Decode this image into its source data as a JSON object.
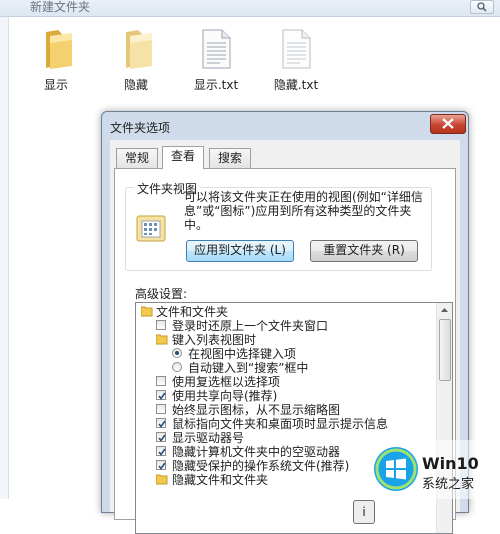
{
  "explorer": {
    "folder_name": "新建文件夹",
    "files": [
      {
        "name": "显示",
        "type": "folder"
      },
      {
        "name": "隐藏",
        "type": "folder"
      },
      {
        "name": "显示.txt",
        "type": "text-file"
      },
      {
        "name": "隐藏.txt",
        "type": "text-file"
      }
    ]
  },
  "dialog": {
    "title": "文件夹选项",
    "tabs": [
      "常规",
      "查看",
      "搜索"
    ],
    "active_tab": "查看",
    "folder_views": {
      "group_title": "文件夹视图",
      "description": "可以将该文件夹正在使用的视图(例如“详细信息”或“图标”)应用到所有这种类型的文件夹中。",
      "apply_button": "应用到文件夹 (L)",
      "reset_button": "重置文件夹 (R)"
    },
    "advanced_label": "高级设置:",
    "settings": [
      {
        "kind": "folder",
        "checked": null,
        "label": "文件和文件夹"
      },
      {
        "kind": "checkbox",
        "checked": false,
        "label": "登录时还原上一个文件夹窗口"
      },
      {
        "kind": "subfolder",
        "checked": null,
        "label": "键入列表视图时"
      },
      {
        "kind": "radio",
        "checked": true,
        "label": "在视图中选择键入项"
      },
      {
        "kind": "radio",
        "checked": false,
        "label": "自动键入到“搜索”框中"
      },
      {
        "kind": "checkbox",
        "checked": false,
        "label": "使用复选框以选择项"
      },
      {
        "kind": "checkbox",
        "checked": true,
        "label": "使用共享向导(推荐)"
      },
      {
        "kind": "checkbox",
        "checked": false,
        "label": "始终显示图标，从不显示缩略图"
      },
      {
        "kind": "checkbox",
        "checked": true,
        "label": "鼠标指向文件夹和桌面项时显示提示信息"
      },
      {
        "kind": "checkbox",
        "checked": true,
        "label": "显示驱动器号"
      },
      {
        "kind": "checkbox",
        "checked": true,
        "label": "隐藏计算机文件夹中的空驱动器"
      },
      {
        "kind": "checkbox",
        "checked": true,
        "label": "隐藏受保护的操作系统文件(推荐)"
      },
      {
        "kind": "subfolder",
        "checked": null,
        "label": "隐藏文件和文件夹"
      }
    ],
    "bottom_button_partial": "i"
  },
  "watermark": {
    "brand": "Win10",
    "site": "系统之家"
  },
  "colors": {
    "dialog_frame": "#cfdbea",
    "close_button": "#c7462f",
    "folder_yellow": "#f2c94c",
    "windows_logo_blue": "#1aa3e8"
  }
}
